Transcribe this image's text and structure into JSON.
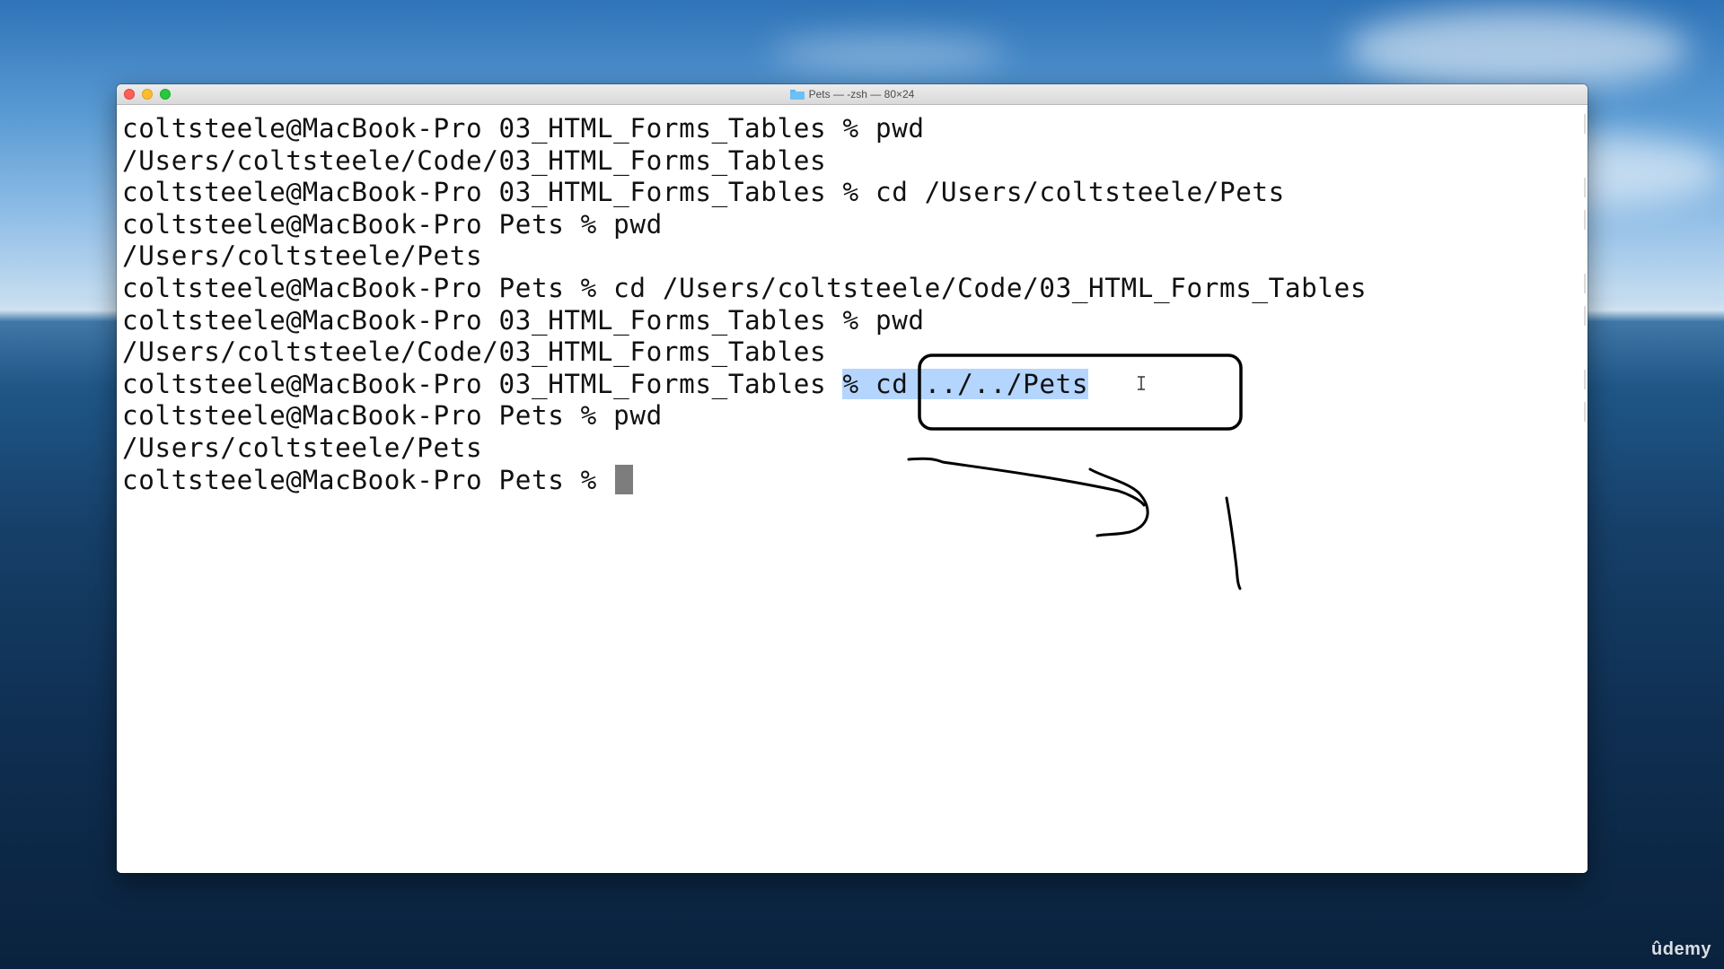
{
  "window": {
    "title": "Pets — -zsh — 80×24",
    "folder_icon": "folder-icon"
  },
  "terminal": {
    "lines": [
      "coltsteele@MacBook-Pro 03_HTML_Forms_Tables % pwd",
      "/Users/coltsteele/Code/03_HTML_Forms_Tables",
      "coltsteele@MacBook-Pro 03_HTML_Forms_Tables % cd /Users/coltsteele/Pets",
      "coltsteele@MacBook-Pro Pets % pwd",
      "/Users/coltsteele/Pets",
      "coltsteele@MacBook-Pro Pets % cd /Users/coltsteele/Code/03_HTML_Forms_Tables",
      "coltsteele@MacBook-Pro 03_HTML_Forms_Tables % pwd",
      "/Users/coltsteele/Code/03_HTML_Forms_Tables"
    ],
    "highlight_line": {
      "prefix": "coltsteele@MacBook-Pro 03_HTML_Forms_Tables ",
      "selected": "% cd ../../Pets"
    },
    "after_lines": [
      "coltsteele@MacBook-Pro Pets % pwd",
      "/Users/coltsteele/Pets"
    ],
    "prompt": "coltsteele@MacBook-Pro Pets % ",
    "selection_color": "#b4d5fe",
    "text_color": "#111111"
  },
  "watermark": "ûdemy"
}
